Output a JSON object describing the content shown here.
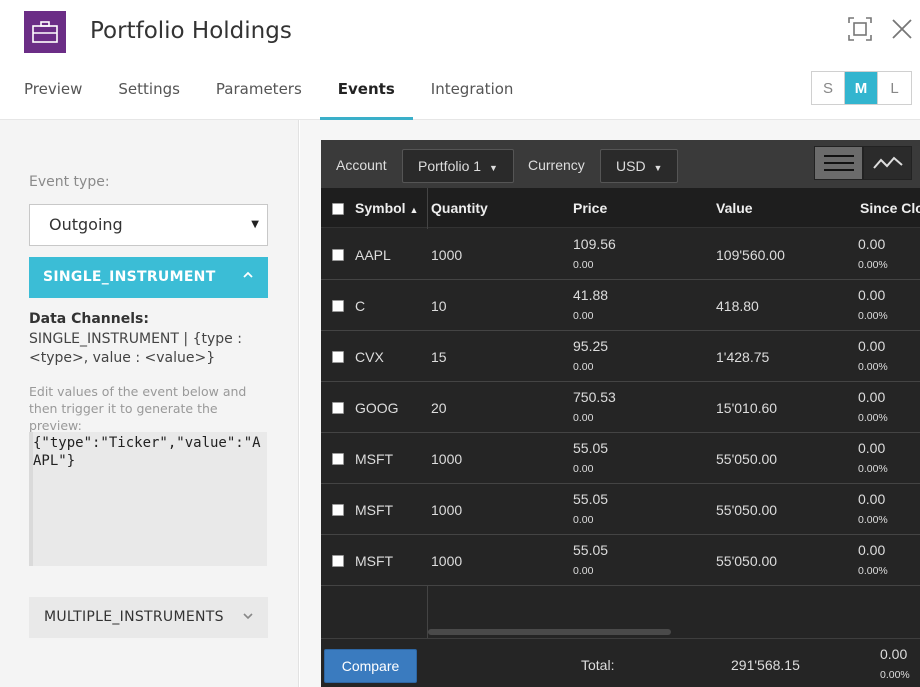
{
  "header": {
    "title": "Portfolio Holdings",
    "tabs": [
      {
        "label": "Preview"
      },
      {
        "label": "Settings"
      },
      {
        "label": "Parameters"
      },
      {
        "label": "Events"
      },
      {
        "label": "Integration"
      }
    ],
    "active_tab": "Events",
    "sizes": [
      "S",
      "M",
      "L"
    ],
    "active_size": "M",
    "accent_color": "#3bbdd6",
    "brand_color": "#6b2d86"
  },
  "left": {
    "event_type_label": "Event type:",
    "event_type_value": "Outgoing",
    "active_section": "SINGLE_INSTRUMENT",
    "data_channels_title": "Data Channels:",
    "data_channels_text": "SINGLE_INSTRUMENT | {type : <type>, value : <value>}",
    "edit_help": "Edit values of the event below and then trigger it to generate the preview:",
    "json_value": "{\"type\":\"Ticker\",\"value\":\"AAPL\"}",
    "collapsed_section": "MULTIPLE_INSTRUMENTS"
  },
  "widget": {
    "account_label": "Account",
    "account_value": "Portfolio 1",
    "currency_label": "Currency",
    "currency_value": "USD",
    "columns": [
      "Symbol",
      "Quantity",
      "Price",
      "Value",
      "Since Clo"
    ],
    "rows": [
      {
        "symbol": "AAPL",
        "quantity": "1000",
        "price": "109.56",
        "price_sub": "0.00",
        "value": "109'560.00",
        "since": "0.00",
        "since_sub": "0.00%"
      },
      {
        "symbol": "C",
        "quantity": "10",
        "price": "41.88",
        "price_sub": "0.00",
        "value": "418.80",
        "since": "0.00",
        "since_sub": "0.00%"
      },
      {
        "symbol": "CVX",
        "quantity": "15",
        "price": "95.25",
        "price_sub": "0.00",
        "value": "1'428.75",
        "since": "0.00",
        "since_sub": "0.00%"
      },
      {
        "symbol": "GOOG",
        "quantity": "20",
        "price": "750.53",
        "price_sub": "0.00",
        "value": "15'010.60",
        "since": "0.00",
        "since_sub": "0.00%"
      },
      {
        "symbol": "MSFT",
        "quantity": "1000",
        "price": "55.05",
        "price_sub": "0.00",
        "value": "55'050.00",
        "since": "0.00",
        "since_sub": "0.00%"
      },
      {
        "symbol": "MSFT",
        "quantity": "1000",
        "price": "55.05",
        "price_sub": "0.00",
        "value": "55'050.00",
        "since": "0.00",
        "since_sub": "0.00%"
      },
      {
        "symbol": "MSFT",
        "quantity": "1000",
        "price": "55.05",
        "price_sub": "0.00",
        "value": "55'050.00",
        "since": "0.00",
        "since_sub": "0.00%"
      }
    ],
    "compare_label": "Compare",
    "total_label": "Total:",
    "total_value": "291'568.15",
    "total_since": "0.00",
    "total_since_sub": "0.00%",
    "compare_color": "#3a7bbf"
  }
}
